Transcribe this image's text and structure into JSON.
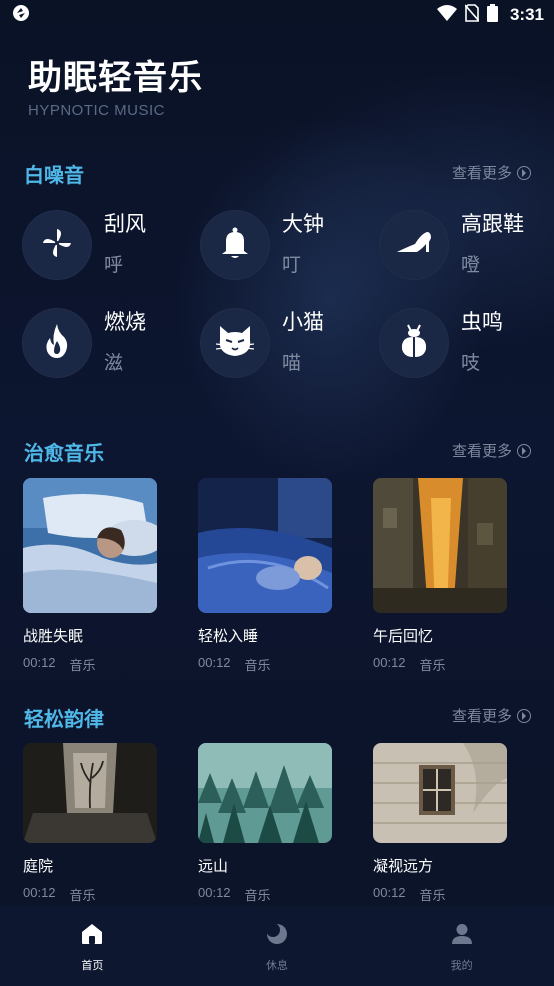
{
  "status": {
    "time": "3:31",
    "icons": [
      "app-logo-icon",
      "wifi-icon",
      "no-sim-icon",
      "battery-icon"
    ]
  },
  "header": {
    "title": "助眠轻音乐",
    "subtitle": "HYPNOTIC MUSIC"
  },
  "white_noise": {
    "title": "白噪音",
    "more": "查看更多",
    "items": [
      {
        "name": "刮风",
        "sound": "呼",
        "icon": "pinwheel-icon"
      },
      {
        "name": "大钟",
        "sound": "叮",
        "icon": "bell-icon"
      },
      {
        "name": "高跟鞋",
        "sound": "噔",
        "icon": "high-heel-icon"
      },
      {
        "name": "燃烧",
        "sound": "滋",
        "icon": "flame-icon"
      },
      {
        "name": "小猫",
        "sound": "喵",
        "icon": "cat-icon"
      },
      {
        "name": "虫鸣",
        "sound": "吱",
        "icon": "bug-icon"
      }
    ]
  },
  "healing": {
    "title": "治愈音乐",
    "more": "查看更多",
    "items": [
      {
        "title": "战胜失眠",
        "duration": "00:12",
        "type": "音乐"
      },
      {
        "title": "轻松入睡",
        "duration": "00:12",
        "type": "音乐"
      },
      {
        "title": "午后回忆",
        "duration": "00:12",
        "type": "音乐"
      }
    ]
  },
  "relax": {
    "title": "轻松韵律",
    "more": "查看更多",
    "items": [
      {
        "title": "庭院",
        "duration": "00:12",
        "type": "音乐"
      },
      {
        "title": "远山",
        "duration": "00:12",
        "type": "音乐"
      },
      {
        "title": "凝视远方",
        "duration": "00:12",
        "type": "音乐"
      }
    ]
  },
  "tabs": [
    {
      "label": "首页",
      "icon": "home-icon",
      "active": true
    },
    {
      "label": "休息",
      "icon": "moon-icon",
      "active": false
    },
    {
      "label": "我的",
      "icon": "user-icon",
      "active": false
    }
  ],
  "colors": {
    "background": "#0c1428",
    "accent": "#4fb8e8",
    "circle": "#1a2745",
    "muted": "#7f8aa0"
  }
}
